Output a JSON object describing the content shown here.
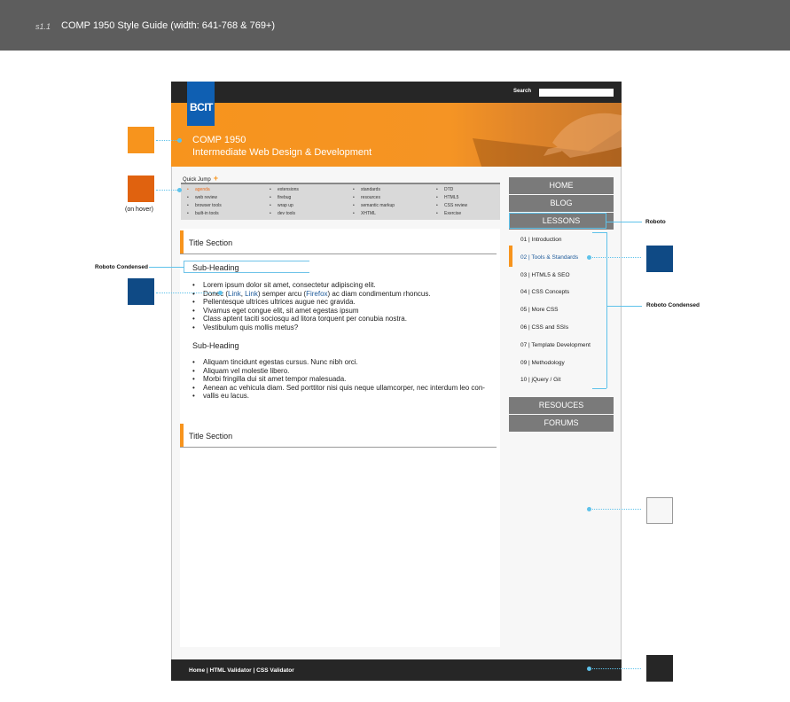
{
  "header": {
    "section_number": "s1.1",
    "title": "COMP 1950 Style Guide (width: 641-768 & 769+)"
  },
  "site": {
    "search_label": "Search",
    "search_value": "",
    "logo_text": "BCIT",
    "course_code": "COMP 1950",
    "course_name": "Intermediate Web Design & Development"
  },
  "quick_jump": {
    "label": "Quick Jump",
    "plus": "+",
    "columns": [
      [
        "agenda",
        "web review",
        "browser tools",
        "built-in tools"
      ],
      [
        "extensions",
        "firebug",
        "wrap up",
        "dev tools"
      ],
      [
        "standards",
        "resources",
        "semantic markup",
        "XHTML"
      ],
      [
        "DTD",
        "HTML5",
        "CSS review",
        "Exercise"
      ]
    ]
  },
  "content": {
    "section1_title": "Title Section",
    "subheading1": "Sub-Heading",
    "list1": {
      "item1": "Lorem ipsum dolor sit amet, consectetur adipiscing elit.",
      "item2_pre": "Donec ",
      "item2_link1": "Link",
      "item2_sep": ", ",
      "item2_link2": "Link",
      "item2_mid": ") semper arcu (",
      "item2_link3": "Firefox",
      "item2_post": ") ac diam condimentum rhoncus.",
      "item3": "Pellentesque ultrices ultrices augue nec gravida.",
      "item4": "Vivamus eget congue elit, sit amet egestas ipsum",
      "item5": "Class aptent taciti sociosqu ad litora torquent per conubia nostra.",
      "item6": "Vestibulum quis mollis metus?"
    },
    "subheading2": "Sub-Heading",
    "list2": [
      "Aliquam tincidunt egestas cursus. Nunc nibh orci.",
      "Aliquam vel molestie libero.",
      "Morbi fringilla dui sit amet tempor malesuada.",
      "Aenean ac vehicula diam. Sed porttitor nisi quis neque ullamcorper, nec interdum leo con-",
      "vallis eu lacus."
    ],
    "section2_title": "Title Section"
  },
  "nav": {
    "home": "HOME",
    "blog": "BLOG",
    "lessons": "LESSONS",
    "lesson_items": [
      "01 | Introduction",
      "02 | Tools & Standards",
      "03 | HTML5 & SEO",
      "04 | CSS Concepts",
      "05 | More CSS",
      "06 | CSS and SSIs",
      "07 | Template Development",
      "09 | Methodology",
      "10 | jQuery / Git"
    ],
    "resources": "RESOUCES",
    "forums": "FORUMS"
  },
  "footer": {
    "home": "Home",
    "sep": "|",
    "html_validator": "HTML Validator",
    "css_validator": "CSS Validator"
  },
  "annotations": {
    "on_hover": "(on hover)",
    "roboto": "Roboto",
    "roboto_condensed_left": "Roboto Condensed",
    "roboto_condensed_right": "Roboto Condensed"
  },
  "colors": {
    "orange": "#f7941d",
    "orange_hover": "#e0620f",
    "blue": "#0f4a85",
    "light_gray": "#f7f7f7",
    "dark": "#262626",
    "nav_gray": "#7a7a7a"
  }
}
